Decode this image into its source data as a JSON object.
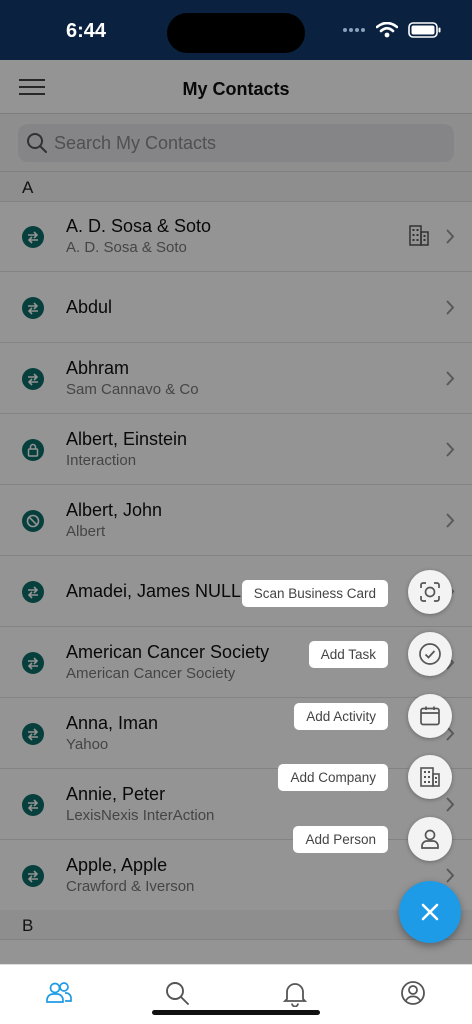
{
  "status_bar": {
    "time": "6:44"
  },
  "header": {
    "title": "My Contacts"
  },
  "search": {
    "placeholder": "Search My Contacts"
  },
  "sections": [
    {
      "letter": "A"
    },
    {
      "letter": "B"
    }
  ],
  "contacts": [
    {
      "name": "A. D. Sosa & Soto",
      "sub": "A. D. Sosa & Soto",
      "status_icon": "sync-arrows-icon",
      "company_icon": true
    },
    {
      "name": "Abdul",
      "sub": "",
      "status_icon": "sync-arrows-icon"
    },
    {
      "name": "Abhram",
      "sub": "Sam Cannavo & Co",
      "status_icon": "sync-arrows-icon"
    },
    {
      "name": "Albert, Einstein",
      "sub": "Interaction",
      "status_icon": "lock-icon"
    },
    {
      "name": "Albert, John",
      "sub": "Albert",
      "status_icon": "blocked-icon"
    },
    {
      "name": "Amadei, James NULL",
      "sub": "",
      "status_icon": "sync-arrows-icon"
    },
    {
      "name": "American Cancer Society",
      "sub": "American Cancer Society",
      "status_icon": "sync-arrows-icon"
    },
    {
      "name": "Anna, Iman",
      "sub": "Yahoo",
      "status_icon": "sync-arrows-icon"
    },
    {
      "name": "Annie, Peter",
      "sub": "LexisNexis InterAction",
      "status_icon": "sync-arrows-icon"
    },
    {
      "name": "Apple, Apple",
      "sub": "Crawford & Iverson",
      "status_icon": "sync-arrows-icon"
    }
  ],
  "fab_menu": {
    "items": [
      {
        "label": "Scan Business Card",
        "icon": "scan-frame-icon"
      },
      {
        "label": "Add Task",
        "icon": "check-circle-icon"
      },
      {
        "label": "Add Activity",
        "icon": "calendar-icon"
      },
      {
        "label": "Add Company",
        "icon": "building-icon"
      },
      {
        "label": "Add Person",
        "icon": "person-icon"
      }
    ],
    "close_icon": "close-icon"
  },
  "tab_bar": {
    "tabs": [
      {
        "icon": "contacts-icon",
        "active": true
      },
      {
        "icon": "search-icon",
        "active": false
      },
      {
        "icon": "bell-icon",
        "active": false
      },
      {
        "icon": "profile-icon",
        "active": false
      }
    ]
  },
  "colors": {
    "status_bar": "#0a2240",
    "status_badge": "#0b6d68",
    "fab": "#1e9be6",
    "active_tab": "#1e9be6"
  }
}
